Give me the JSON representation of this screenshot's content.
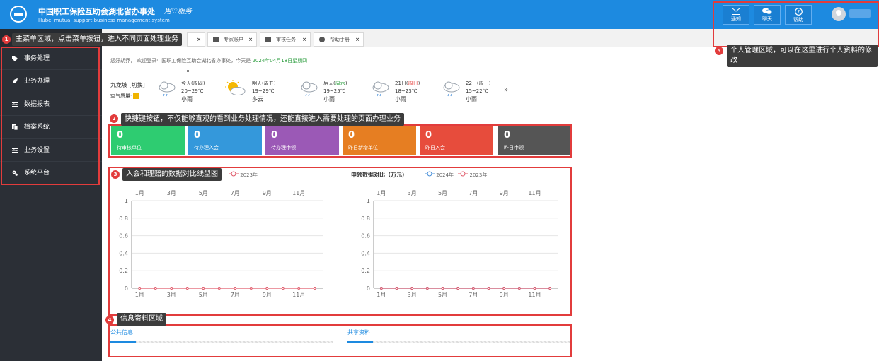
{
  "header": {
    "title_cn": "中国职工保险互助会湖北省办事处",
    "slogan": "用♡服务",
    "title_en": "Hubei mutual support business management system",
    "buttons": [
      {
        "label": "通知",
        "icon": "mail-icon"
      },
      {
        "label": "聊天",
        "icon": "chat-icon"
      },
      {
        "label": "帮助",
        "icon": "help-icon"
      }
    ]
  },
  "sidebar": {
    "items": [
      {
        "label": "事务处理",
        "icon": "tag-icon"
      },
      {
        "label": "业务办理",
        "icon": "leaf-icon"
      },
      {
        "label": "数据报表",
        "icon": "sliders-icon"
      },
      {
        "label": "档案系统",
        "icon": "copy-icon"
      },
      {
        "label": "业务设置",
        "icon": "sliders-icon"
      },
      {
        "label": "系统平台",
        "icon": "gears-icon"
      }
    ]
  },
  "tabs": [
    {
      "label": "专家账户",
      "icon": "box-icon"
    },
    {
      "label": "审核任务",
      "icon": "box-icon"
    },
    {
      "label": "帮助手册",
      "icon": "question-icon"
    }
  ],
  "welcome": {
    "greeting": "您好胡乔，",
    "text": "欢迎登录中国职工保险互助会湖北省办事处，今天是",
    "date": "2024年04月18日星期四"
  },
  "weather": {
    "city": "九龙坡",
    "switch_label": "[切换]",
    "air_quality_label": "空气质量:",
    "days": [
      {
        "day": "今天(周四)",
        "temp": "20~29℃",
        "cond": "小雨",
        "icon": "rain-cloud-icon"
      },
      {
        "day": "明天(周五)",
        "temp": "19~29℃",
        "cond": "多云",
        "icon": "sun-cloud-icon"
      },
      {
        "day_prefix": "后天(",
        "day_mark": "周六",
        "day_suffix": ")",
        "temp": "19~25℃",
        "cond": "小雨",
        "icon": "rain-cloud-icon",
        "mark_color": "#2a9c3c"
      },
      {
        "day_prefix": "21日(",
        "day_mark": "周日",
        "day_suffix": ")",
        "temp": "18~23℃",
        "cond": "小雨",
        "icon": "rain-cloud-icon",
        "mark_color": "#e53935"
      },
      {
        "day": "22日(周一)",
        "temp": "15~22℃",
        "cond": "小雨",
        "icon": "rain-cloud-icon"
      }
    ],
    "more": "»"
  },
  "cards": [
    {
      "value": "0",
      "label": "待审核单位",
      "color": "#2ecc71"
    },
    {
      "value": "0",
      "label": "待办理入会",
      "color": "#3498db"
    },
    {
      "value": "0",
      "label": "待办理申领",
      "color": "#9b59b6"
    },
    {
      "value": "0",
      "label": "昨日新增单位",
      "color": "#e67e22"
    },
    {
      "value": "0",
      "label": "昨日入会",
      "color": "#e74c3c"
    },
    {
      "value": "0",
      "label": "昨日申领",
      "color": "#555555"
    }
  ],
  "chart_data": [
    {
      "type": "line",
      "title": "",
      "categories": [
        "1月",
        "2月",
        "3月",
        "4月",
        "5月",
        "6月",
        "7月",
        "8月",
        "9月",
        "10月",
        "11月",
        "12月"
      ],
      "x_tick_labels": [
        "1月",
        "3月",
        "5月",
        "7月",
        "9月",
        "11月"
      ],
      "series": [
        {
          "name": "2023年",
          "values": [
            0,
            0,
            0,
            0,
            0,
            0,
            0,
            0,
            0,
            0,
            0,
            0
          ],
          "color": "#e05a6a"
        }
      ],
      "ylim": [
        0,
        1
      ],
      "y_ticks": [
        "0",
        "0.2",
        "0.4",
        "0.6",
        "0.8",
        "1"
      ],
      "legend": "top"
    },
    {
      "type": "line",
      "title": "申领数据对比（万元）",
      "categories": [
        "1月",
        "2月",
        "3月",
        "4月",
        "5月",
        "6月",
        "7月",
        "8月",
        "9月",
        "10月",
        "11月",
        "12月"
      ],
      "x_tick_labels": [
        "1月",
        "3月",
        "5月",
        "7月",
        "9月",
        "11月"
      ],
      "series": [
        {
          "name": "2024年",
          "values": [
            0,
            0,
            0,
            0,
            0,
            0,
            0,
            0,
            0,
            0,
            0,
            0
          ],
          "color": "#4a90d9"
        },
        {
          "name": "2023年",
          "values": [
            0,
            0,
            0,
            0,
            0,
            0,
            0,
            0,
            0,
            0,
            0,
            0
          ],
          "color": "#e05a6a"
        }
      ],
      "ylim": [
        0,
        1
      ],
      "y_ticks": [
        "0",
        "0.2",
        "0.4",
        "0.6",
        "0.8",
        "1"
      ],
      "legend": "top"
    }
  ],
  "info": {
    "tabs": [
      "公共信息",
      "共享资料"
    ]
  },
  "annotations": [
    {
      "num": "1",
      "text": "主菜单区域，点击菜单按钮，进入不同页面处理业务"
    },
    {
      "num": "2",
      "text": "快捷键按钮，不仅能够直观的看到业务处理情况，还能直接进入需要处理的页面办理业务"
    },
    {
      "num": "3",
      "text": "入会和理赔的数据对比线型图"
    },
    {
      "num": "4",
      "text": "信息资料区域"
    },
    {
      "num": "5",
      "text": "个人管理区域，可以在这里进行个人资料的修改"
    }
  ]
}
